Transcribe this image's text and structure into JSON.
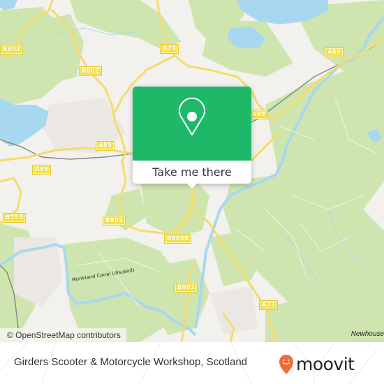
{
  "map": {
    "road_labels": [
      {
        "id": "b803",
        "text": "B803"
      },
      {
        "id": "a73-north",
        "text": "A73"
      },
      {
        "id": "b802-north",
        "text": "B802"
      },
      {
        "id": "a89-east",
        "text": "A89"
      },
      {
        "id": "a89-center",
        "text": "A89"
      },
      {
        "id": "a89-west",
        "text": "A89"
      },
      {
        "id": "a89-west2",
        "text": "A89"
      },
      {
        "id": "b753",
        "text": "B753"
      },
      {
        "id": "b802-mid",
        "text": "B802"
      },
      {
        "id": "b8058",
        "text": "B8058"
      },
      {
        "id": "b802-south",
        "text": "B802"
      },
      {
        "id": "a73-south",
        "text": "A73"
      }
    ],
    "waterway_label": "Monkland Canal (disused)",
    "place_label": "Newhouse",
    "attribution": "© OpenStreetMap contributors",
    "colors": {
      "land": "#f2f1ed",
      "woodland": "#cfe5b0",
      "water": "#a8d8ef",
      "road": "#f5dc6a",
      "rail": "#888888"
    }
  },
  "popup": {
    "icon": "location-pin-icon",
    "action_label": "Take me there",
    "accent_color": "#1db868"
  },
  "footer": {
    "title": "Girders Scooter & Motorcycle Workshop, Scotland",
    "brand": "moovit",
    "brand_icon": "moovit-smile-pin-icon",
    "brand_color": "#f26a3a"
  }
}
